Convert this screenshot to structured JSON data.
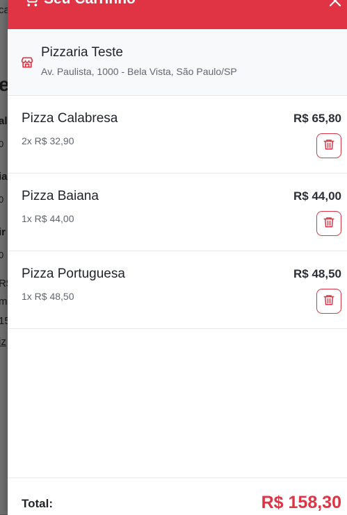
{
  "background": {
    "fragments": [
      "ca",
      "e",
      "ala",
      "0",
      "ia",
      "0",
      "ir",
      "0",
      "R$",
      "m",
      "15",
      "iz"
    ]
  },
  "drawer": {
    "title": "Seu Carrinho",
    "close_icon": "close-icon",
    "cart_icon": "shopping-cart-icon"
  },
  "store": {
    "name": "Pizzaria Teste",
    "address": "Av. Paulista, 1000 - Bela Vista, São Paulo/SP",
    "icon": "storefront-icon"
  },
  "items": [
    {
      "name": "Pizza Calabresa",
      "qty": "2x R$ 32,90",
      "price": "R$ 65,80"
    },
    {
      "name": "Pizza Baiana",
      "qty": "1x R$ 44,00",
      "price": "R$ 44,00"
    },
    {
      "name": "Pizza Portuguesa",
      "qty": "1x R$ 48,50",
      "price": "R$ 48,50"
    }
  ],
  "footer": {
    "total_label": "Total:",
    "total_value": "R$ 158,30"
  },
  "colors": {
    "accent": "#e03344",
    "text": "#1f2328",
    "muted": "#5f6670"
  }
}
